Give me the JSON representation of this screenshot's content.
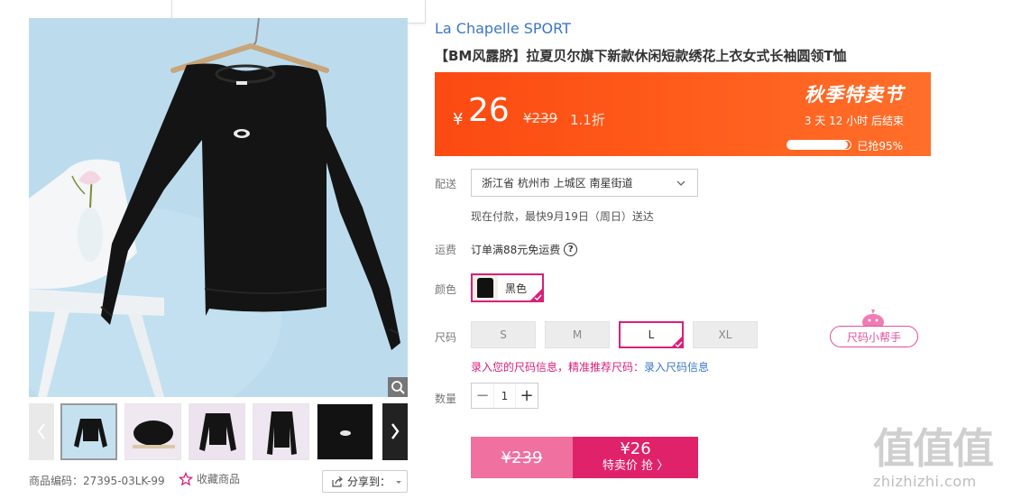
{
  "product": {
    "brand": "La Chapelle SPORT",
    "title": "【BM风露脐】拉夏贝尔旗下新款休闲短款绣花上衣女式长袖圆领T恤",
    "code_label": "商品编码：",
    "code": "27395-03LK-99",
    "favorite_label": "收藏商品",
    "share_label": "分享到："
  },
  "promo": {
    "currency": "¥",
    "price": "26",
    "original_price": "¥239",
    "discount": "1.1折",
    "event_name": "秋季特卖节",
    "countdown": "3 天 12 小时 后结束",
    "sold_progress": 0.95,
    "sold_text": "已抢95%",
    "colors": {
      "start": "#fb4a12",
      "end": "#ff6f2a"
    }
  },
  "delivery": {
    "label": "配送",
    "address": "浙江省 杭州市 上城区 南星街道",
    "estimate": "现在付款，最快9月19日（周日）送达"
  },
  "shipping": {
    "label": "运费",
    "text": "订单满88元免运费",
    "help_icon": "question-circle-icon"
  },
  "color": {
    "label": "颜色",
    "selected": "黑色"
  },
  "size": {
    "label": "尺码",
    "options": [
      "S",
      "M",
      "L",
      "XL"
    ],
    "selected": "L",
    "helper": "尺码小帮手",
    "tip": "录入您的尺码信息，精准推荐尺码：",
    "tip_link": "录入尺码信息"
  },
  "quantity": {
    "label": "数量",
    "value": "1",
    "minus": "−",
    "plus": "+"
  },
  "buy": {
    "original": "¥239",
    "price": "¥26",
    "action": "特卖价 抢 〉",
    "accent": "#e0226a"
  },
  "watermark": {
    "logo": "值值值",
    "site": "zhizhizhi.com"
  }
}
